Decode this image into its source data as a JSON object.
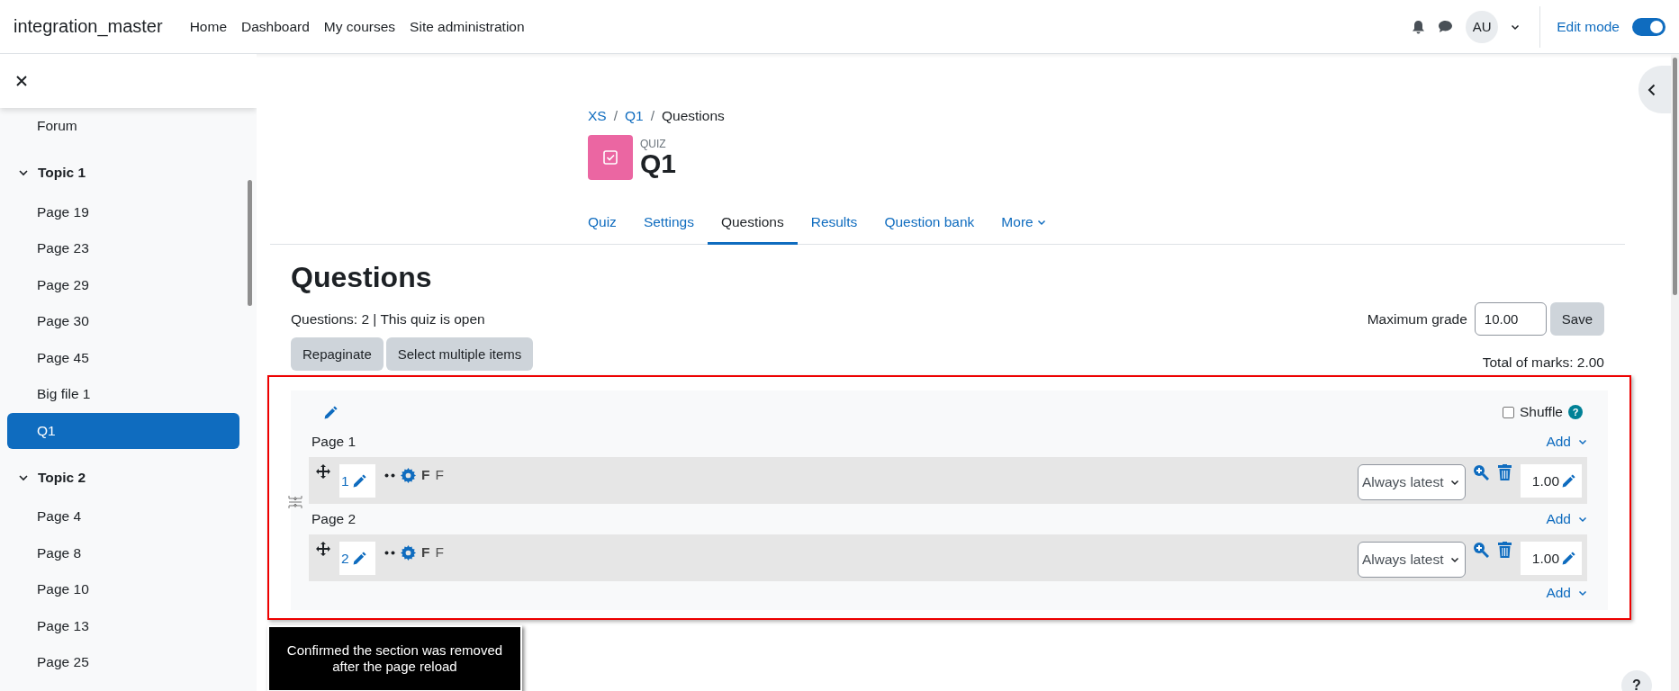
{
  "navbar": {
    "brand": "integration_master",
    "links": [
      "Home",
      "Dashboard",
      "My courses",
      "Site administration"
    ],
    "avatar": "AU",
    "edit_mode": {
      "label": "Edit mode",
      "on": true
    }
  },
  "sidebar": {
    "items": [
      {
        "kind": "activity",
        "label": "Forum",
        "selected": false
      },
      {
        "kind": "section",
        "label": "Topic 1",
        "expanded": true,
        "children": [
          {
            "label": "Page 19",
            "selected": false
          },
          {
            "label": "Page 23",
            "selected": false
          },
          {
            "label": "Page 29",
            "selected": false
          },
          {
            "label": "Page 30",
            "selected": false
          },
          {
            "label": "Page 45",
            "selected": false
          },
          {
            "label": "Big file 1",
            "selected": false
          },
          {
            "label": "Q1",
            "selected": true
          }
        ]
      },
      {
        "kind": "section",
        "label": "Topic 2",
        "expanded": true,
        "children": [
          {
            "label": "Page 4",
            "selected": false
          },
          {
            "label": "Page 8",
            "selected": false
          },
          {
            "label": "Page 10",
            "selected": false
          },
          {
            "label": "Page 13",
            "selected": false
          },
          {
            "label": "Page 25",
            "selected": false
          }
        ]
      }
    ]
  },
  "breadcrumb": {
    "separator": "/",
    "items": [
      "XS",
      "Q1",
      "Questions"
    ]
  },
  "help_button": "?",
  "header": {
    "module_type": "QUIZ",
    "title": "Q1"
  },
  "tabs": [
    {
      "label": "Quiz",
      "kind": "tab",
      "selected": false
    },
    {
      "label": "Settings",
      "kind": "tab",
      "selected": false
    },
    {
      "label": "Questions",
      "kind": "tab",
      "selected": true
    },
    {
      "label": "Results",
      "kind": "tab",
      "selected": false
    },
    {
      "label": "Question bank",
      "kind": "tab",
      "selected": false
    },
    {
      "label": "More",
      "kind": "menu",
      "selected": false
    }
  ],
  "page": {
    "heading": "Questions",
    "info": "Questions: 2 | This quiz is open",
    "max_grade_label": "Maximum grade",
    "max_grade_value": "10.00",
    "save": "Save",
    "buttons": [
      "Repaginate",
      "Select multiple items"
    ],
    "total": "Total of marks: 2.00"
  },
  "section": {
    "shuffle": {
      "label": "Shuffle",
      "checked": false,
      "help": "?"
    },
    "pages": [
      {
        "title": "Page 1",
        "add": "Add",
        "slots": [
          {
            "number": "1",
            "name": "F",
            "text": "F",
            "version": "Always latest",
            "mark": "1.00"
          }
        ]
      },
      {
        "title": "Page 2",
        "add": "Add",
        "slots": [
          {
            "number": "2",
            "name": "F",
            "text": "F",
            "version": "Always latest",
            "mark": "1.00"
          }
        ]
      }
    ],
    "final_add": "Add"
  },
  "annotation": {
    "caption": "Confirmed the section was removed after the page reload"
  }
}
